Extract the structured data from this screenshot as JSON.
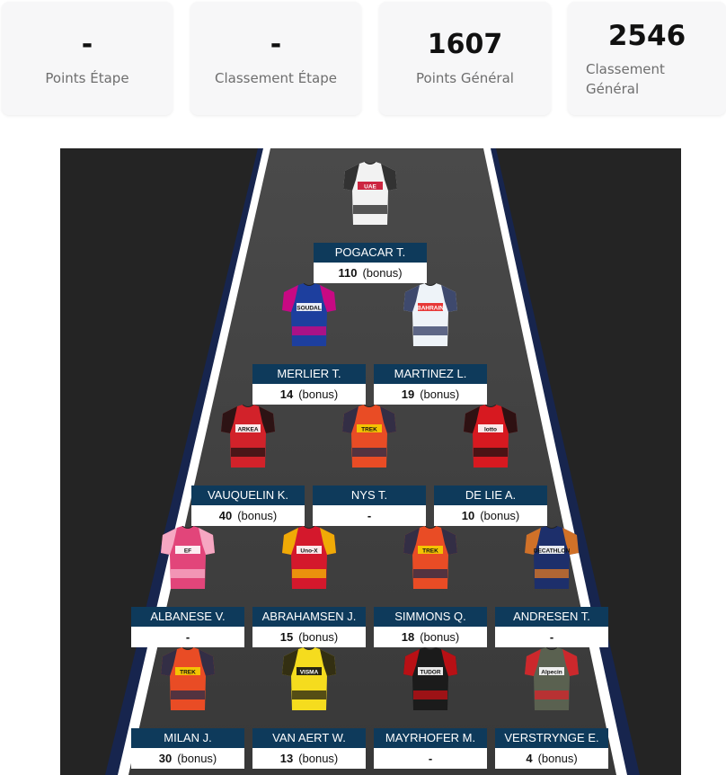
{
  "stats": [
    {
      "value": "-",
      "label": "Points Étape"
    },
    {
      "value": "-",
      "label": "Classement Étape"
    },
    {
      "value": "1607",
      "label": "Points Général"
    },
    {
      "value": "2546",
      "label": "Classement Général"
    }
  ],
  "riders": [
    {
      "name": "POGACAR T.",
      "points": "110",
      "bonus": "(bonus)",
      "jersey": {
        "main": "#f2f2f2",
        "accent": "#111111",
        "stripe": "#c8102e",
        "text": "UAE"
      }
    },
    {
      "name": "MERLIER T.",
      "points": "14",
      "bonus": "(bonus)",
      "jersey": {
        "main": "#1d3f9e",
        "accent": "#e6007e",
        "stripe": "#ffffff",
        "text": "SOUDAL"
      }
    },
    {
      "name": "MARTINEZ L.",
      "points": "19",
      "bonus": "(bonus)",
      "jersey": {
        "main": "#eef3f8",
        "accent": "#1f2a55",
        "stripe": "#e52421",
        "text": "BAHRAIN"
      }
    },
    {
      "name": "VAUQUELIN K.",
      "points": "40",
      "bonus": "(bonus)",
      "jersey": {
        "main": "#d2222a",
        "accent": "#111111",
        "stripe": "#ffffff",
        "text": "ARKEA"
      }
    },
    {
      "name": "NYS T.",
      "points": "-",
      "bonus": "",
      "jersey": {
        "main": "#e94c25",
        "accent": "#13294b",
        "stripe": "#f5d000",
        "text": "TREK"
      }
    },
    {
      "name": "DE LIE A.",
      "points": "10",
      "bonus": "(bonus)",
      "jersey": {
        "main": "#d71920",
        "accent": "#111111",
        "stripe": "#ffffff",
        "text": "lotto"
      }
    },
    {
      "name": "ALBANESE V.",
      "points": "-",
      "bonus": "",
      "jersey": {
        "main": "#e2457a",
        "accent": "#f9b8cf",
        "stripe": "#ffffff",
        "text": "EF"
      }
    },
    {
      "name": "ABRAHAMSEN J.",
      "points": "15",
      "bonus": "(bonus)",
      "jersey": {
        "main": "#d4182c",
        "accent": "#f5c400",
        "stripe": "#ffffff",
        "text": "Uno-X"
      }
    },
    {
      "name": "SIMMONS Q.",
      "points": "18",
      "bonus": "(bonus)",
      "jersey": {
        "main": "#e94c25",
        "accent": "#13294b",
        "stripe": "#f5d000",
        "text": "TREK"
      }
    },
    {
      "name": "ANDRESEN T.",
      "points": "-",
      "bonus": "",
      "jersey": {
        "main": "#1d2f6b",
        "accent": "#f07d1c",
        "stripe": "#ffffff",
        "text": "DECATHLON"
      }
    },
    {
      "name": "MILAN J.",
      "points": "30",
      "bonus": "(bonus)",
      "jersey": {
        "main": "#e94c25",
        "accent": "#13294b",
        "stripe": "#f5d000",
        "text": "TREK"
      }
    },
    {
      "name": "VAN AERT W.",
      "points": "13",
      "bonus": "(bonus)",
      "jersey": {
        "main": "#f5dc1e",
        "accent": "#111111",
        "stripe": "#111111",
        "text": "VISMA"
      }
    },
    {
      "name": "MAYRHOFER M.",
      "points": "-",
      "bonus": "",
      "jersey": {
        "main": "#1b1b1b",
        "accent": "#d40e14",
        "stripe": "#ffffff",
        "text": "TUDOR"
      }
    },
    {
      "name": "VERSTRYNGE E.",
      "points": "4",
      "bonus": "(bonus)",
      "jersey": {
        "main": "#5a6150",
        "accent": "#e01e26",
        "stripe": "#ffffff",
        "text": "Alpecin"
      }
    }
  ]
}
